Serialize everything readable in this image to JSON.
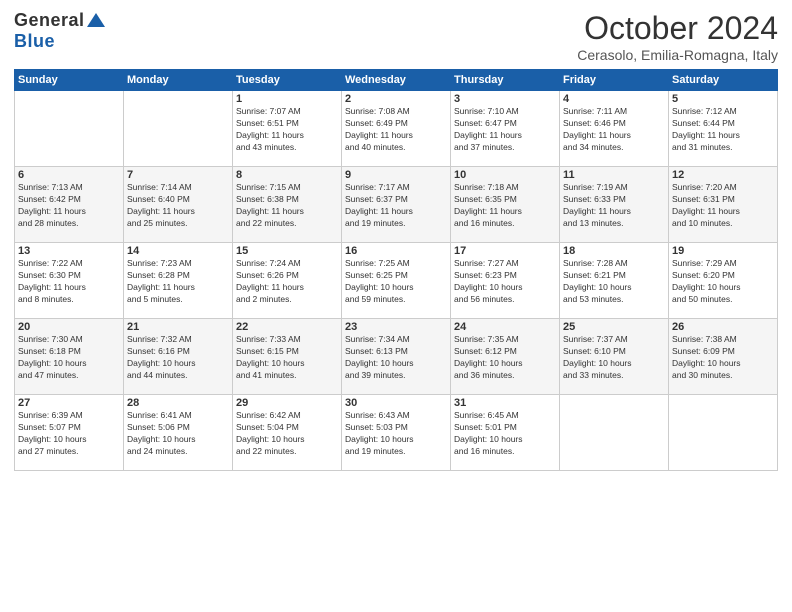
{
  "logo": {
    "general": "General",
    "blue": "Blue"
  },
  "title": "October 2024",
  "location": "Cerasolo, Emilia-Romagna, Italy",
  "days_of_week": [
    "Sunday",
    "Monday",
    "Tuesday",
    "Wednesday",
    "Thursday",
    "Friday",
    "Saturday"
  ],
  "weeks": [
    [
      {
        "day": "",
        "info": ""
      },
      {
        "day": "",
        "info": ""
      },
      {
        "day": "1",
        "info": "Sunrise: 7:07 AM\nSunset: 6:51 PM\nDaylight: 11 hours\nand 43 minutes."
      },
      {
        "day": "2",
        "info": "Sunrise: 7:08 AM\nSunset: 6:49 PM\nDaylight: 11 hours\nand 40 minutes."
      },
      {
        "day": "3",
        "info": "Sunrise: 7:10 AM\nSunset: 6:47 PM\nDaylight: 11 hours\nand 37 minutes."
      },
      {
        "day": "4",
        "info": "Sunrise: 7:11 AM\nSunset: 6:46 PM\nDaylight: 11 hours\nand 34 minutes."
      },
      {
        "day": "5",
        "info": "Sunrise: 7:12 AM\nSunset: 6:44 PM\nDaylight: 11 hours\nand 31 minutes."
      }
    ],
    [
      {
        "day": "6",
        "info": "Sunrise: 7:13 AM\nSunset: 6:42 PM\nDaylight: 11 hours\nand 28 minutes."
      },
      {
        "day": "7",
        "info": "Sunrise: 7:14 AM\nSunset: 6:40 PM\nDaylight: 11 hours\nand 25 minutes."
      },
      {
        "day": "8",
        "info": "Sunrise: 7:15 AM\nSunset: 6:38 PM\nDaylight: 11 hours\nand 22 minutes."
      },
      {
        "day": "9",
        "info": "Sunrise: 7:17 AM\nSunset: 6:37 PM\nDaylight: 11 hours\nand 19 minutes."
      },
      {
        "day": "10",
        "info": "Sunrise: 7:18 AM\nSunset: 6:35 PM\nDaylight: 11 hours\nand 16 minutes."
      },
      {
        "day": "11",
        "info": "Sunrise: 7:19 AM\nSunset: 6:33 PM\nDaylight: 11 hours\nand 13 minutes."
      },
      {
        "day": "12",
        "info": "Sunrise: 7:20 AM\nSunset: 6:31 PM\nDaylight: 11 hours\nand 10 minutes."
      }
    ],
    [
      {
        "day": "13",
        "info": "Sunrise: 7:22 AM\nSunset: 6:30 PM\nDaylight: 11 hours\nand 8 minutes."
      },
      {
        "day": "14",
        "info": "Sunrise: 7:23 AM\nSunset: 6:28 PM\nDaylight: 11 hours\nand 5 minutes."
      },
      {
        "day": "15",
        "info": "Sunrise: 7:24 AM\nSunset: 6:26 PM\nDaylight: 11 hours\nand 2 minutes."
      },
      {
        "day": "16",
        "info": "Sunrise: 7:25 AM\nSunset: 6:25 PM\nDaylight: 10 hours\nand 59 minutes."
      },
      {
        "day": "17",
        "info": "Sunrise: 7:27 AM\nSunset: 6:23 PM\nDaylight: 10 hours\nand 56 minutes."
      },
      {
        "day": "18",
        "info": "Sunrise: 7:28 AM\nSunset: 6:21 PM\nDaylight: 10 hours\nand 53 minutes."
      },
      {
        "day": "19",
        "info": "Sunrise: 7:29 AM\nSunset: 6:20 PM\nDaylight: 10 hours\nand 50 minutes."
      }
    ],
    [
      {
        "day": "20",
        "info": "Sunrise: 7:30 AM\nSunset: 6:18 PM\nDaylight: 10 hours\nand 47 minutes."
      },
      {
        "day": "21",
        "info": "Sunrise: 7:32 AM\nSunset: 6:16 PM\nDaylight: 10 hours\nand 44 minutes."
      },
      {
        "day": "22",
        "info": "Sunrise: 7:33 AM\nSunset: 6:15 PM\nDaylight: 10 hours\nand 41 minutes."
      },
      {
        "day": "23",
        "info": "Sunrise: 7:34 AM\nSunset: 6:13 PM\nDaylight: 10 hours\nand 39 minutes."
      },
      {
        "day": "24",
        "info": "Sunrise: 7:35 AM\nSunset: 6:12 PM\nDaylight: 10 hours\nand 36 minutes."
      },
      {
        "day": "25",
        "info": "Sunrise: 7:37 AM\nSunset: 6:10 PM\nDaylight: 10 hours\nand 33 minutes."
      },
      {
        "day": "26",
        "info": "Sunrise: 7:38 AM\nSunset: 6:09 PM\nDaylight: 10 hours\nand 30 minutes."
      }
    ],
    [
      {
        "day": "27",
        "info": "Sunrise: 6:39 AM\nSunset: 5:07 PM\nDaylight: 10 hours\nand 27 minutes."
      },
      {
        "day": "28",
        "info": "Sunrise: 6:41 AM\nSunset: 5:06 PM\nDaylight: 10 hours\nand 24 minutes."
      },
      {
        "day": "29",
        "info": "Sunrise: 6:42 AM\nSunset: 5:04 PM\nDaylight: 10 hours\nand 22 minutes."
      },
      {
        "day": "30",
        "info": "Sunrise: 6:43 AM\nSunset: 5:03 PM\nDaylight: 10 hours\nand 19 minutes."
      },
      {
        "day": "31",
        "info": "Sunrise: 6:45 AM\nSunset: 5:01 PM\nDaylight: 10 hours\nand 16 minutes."
      },
      {
        "day": "",
        "info": ""
      },
      {
        "day": "",
        "info": ""
      }
    ]
  ]
}
